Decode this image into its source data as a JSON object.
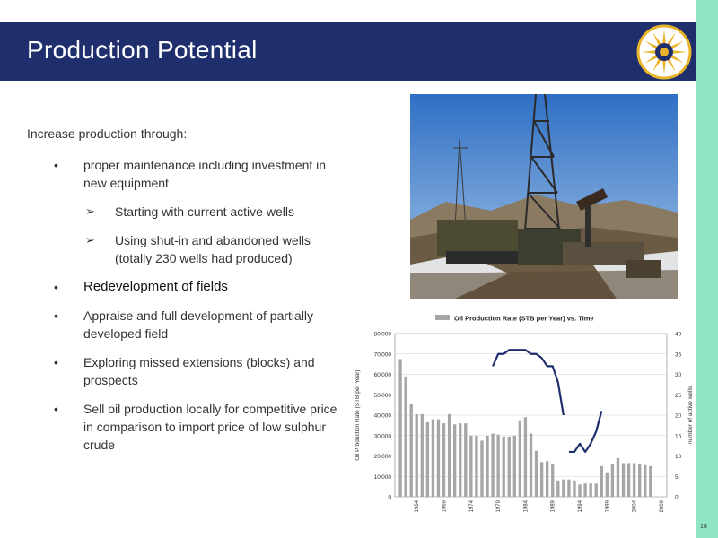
{
  "slide": {
    "title": "Production Potential",
    "page_number": "18",
    "colors": {
      "title_bar": "#1f2f6e",
      "side_stripe": "#8fe6c4",
      "logo": "#e8b52a"
    }
  },
  "content": {
    "intro": "Increase production through:",
    "bullets": [
      {
        "marker": "•",
        "text": "proper maintenance including investment in new equipment"
      },
      {
        "marker": "•",
        "text": "Redevelopment of fields"
      },
      {
        "marker": "•",
        "text": "Appraise and full development of partially developed field"
      },
      {
        "marker": "•",
        "text": "Exploring missed extensions (blocks) and prospects"
      },
      {
        "marker": "•",
        "text": "Sell oil production locally for competitive price in comparison to import price of low sulphur crude"
      }
    ],
    "sub_bullets": [
      {
        "marker": "➢",
        "text": "Starting with current active wells"
      },
      {
        "marker": "➢",
        "text": "Using shut-in and abandoned wells (totally 230 wells had produced)"
      }
    ]
  },
  "chart_data": {
    "type": "bar",
    "title": "Oil Production Rate (STB per Year) vs. Time",
    "legend": [
      "Oil Production Rate (STB per Year) vs. Time"
    ],
    "legend_position": "top",
    "ylabel": "Oil Production Rate (STB per Year)",
    "y2label": "number of active wells",
    "ylim": [
      0,
      80000
    ],
    "y2lim": [
      0,
      40
    ],
    "y_ticks": [
      "0",
      "10'000",
      "20'000",
      "30'000",
      "40'000",
      "50'000",
      "60'000",
      "70'000",
      "80'000"
    ],
    "y2_ticks": [
      "0",
      "5",
      "10",
      "15",
      "20",
      "25",
      "30",
      "35",
      "40"
    ],
    "x_ticks": [
      "1964",
      "1969",
      "1974",
      "1979",
      "1984",
      "1989",
      "1994",
      "1999",
      "2004",
      "2009"
    ],
    "grid": true,
    "years": [
      1961,
      1962,
      1963,
      1964,
      1965,
      1966,
      1967,
      1968,
      1969,
      1970,
      1971,
      1972,
      1973,
      1974,
      1975,
      1976,
      1977,
      1978,
      1979,
      1980,
      1981,
      1982,
      1983,
      1984,
      1985,
      1986,
      1987,
      1988,
      1989,
      1990,
      1991,
      1992,
      1993,
      1994,
      1995,
      1996,
      1997,
      1998,
      1999,
      2000,
      2001,
      2002,
      2003,
      2004,
      2005,
      2006,
      2007,
      2008
    ],
    "production": [
      67500,
      59000,
      45500,
      40500,
      40500,
      36500,
      38000,
      38000,
      36000,
      40500,
      35500,
      36000,
      36000,
      30000,
      30000,
      27500,
      30000,
      31000,
      30500,
      29500,
      29500,
      30000,
      37500,
      39000,
      31000,
      22500,
      17000,
      17500,
      16000,
      8000,
      8500,
      8500,
      8000,
      6000,
      6500,
      6500,
      6500,
      15000,
      12000,
      16000,
      19000,
      16500,
      16500,
      16500,
      16000,
      15500,
      15000,
      0
    ],
    "active_wells_series": [
      {
        "years": [
          1978,
          1979,
          1980,
          1981,
          1982,
          1983,
          1984,
          1985,
          1986,
          1987,
          1988,
          1989,
          1990,
          1991
        ],
        "values": [
          32,
          35,
          35,
          36,
          36,
          36,
          36,
          35,
          35,
          34,
          32,
          32,
          28,
          20
        ]
      },
      {
        "years": [
          1992,
          1993,
          1994,
          1995,
          1996,
          1997,
          1998
        ],
        "values": [
          11,
          11,
          13,
          11,
          13,
          16,
          21
        ]
      }
    ],
    "colors": {
      "bars": "#a6a6a6",
      "line": "#1f2f6e"
    }
  }
}
